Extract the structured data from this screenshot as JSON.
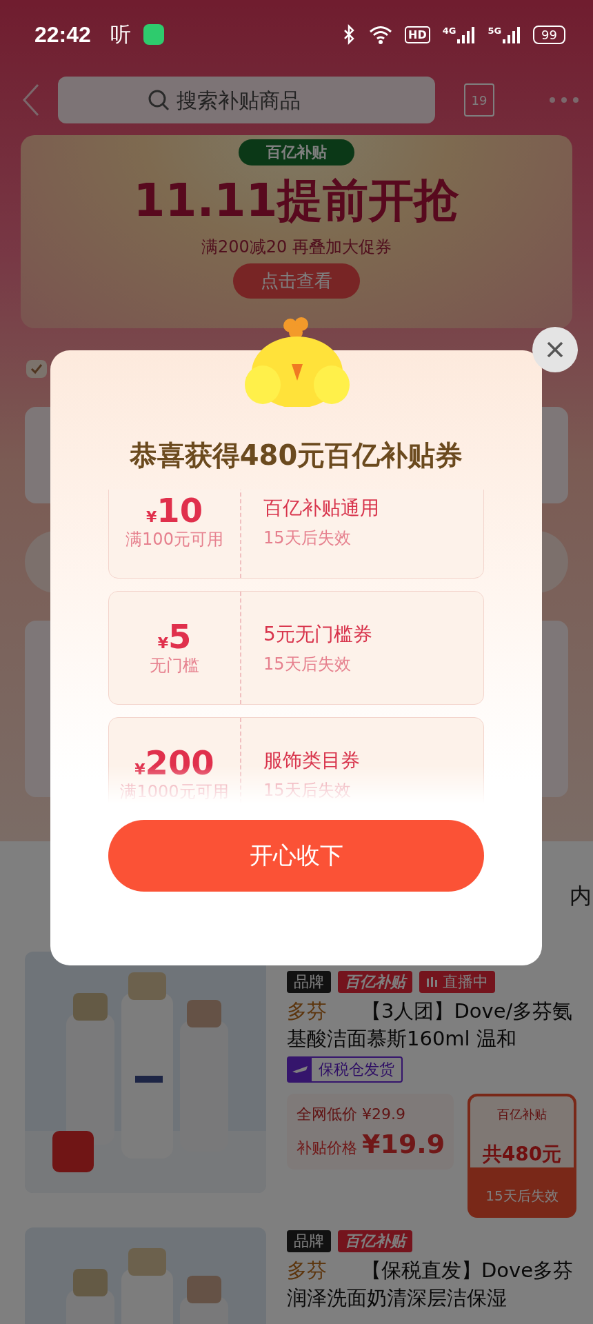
{
  "status_bar": {
    "time": "22:42",
    "app_glyph": "听",
    "network_badges": [
      {
        "kind": "hd",
        "label": "HD"
      },
      {
        "kind": "cell",
        "label": "4G"
      },
      {
        "kind": "cell",
        "label": "5G"
      }
    ],
    "battery": "99"
  },
  "header": {
    "search": {
      "placeholder": "搜索补贴商品"
    },
    "calendar_day": "19"
  },
  "banner": {
    "pill": "百亿补贴",
    "headline": "11.11提前开抢",
    "subline": "满200减20 再叠加大促券",
    "button": "点击查看"
  },
  "tab_fragment": "内",
  "products": [
    {
      "tags": [
        {
          "kind": "brand",
          "label": "品牌"
        },
        {
          "kind": "subsidy",
          "label": "百亿补贴"
        },
        {
          "kind": "live",
          "label": "直播中"
        }
      ],
      "brand": "多芬",
      "title": "【3人团】Dove/多芬氨基酸洁面慕斯160ml 温和",
      "shipping": "保税仓发货",
      "list_price_label": "全网低价",
      "list_price": "¥29.9",
      "subsidy_price_label": "补贴价格",
      "subsidy_price": "¥19.9",
      "voucher": {
        "title": "百亿补贴",
        "amount": "共480元",
        "expiry": "15天后失效"
      }
    },
    {
      "tags": [
        {
          "kind": "brand",
          "label": "品牌"
        },
        {
          "kind": "subsidy",
          "label": "百亿补贴"
        }
      ],
      "brand": "多芬",
      "title": "【保税直发】Dove多芬润泽洗面奶清深层洁保湿"
    }
  ],
  "dialog": {
    "title": "恭喜获得**480元**百亿补贴券",
    "coupons": [
      {
        "currency": "¥",
        "amount": "10",
        "condition": "满100元可用",
        "name": "百亿补贴通用",
        "expiry": "15天后失效"
      },
      {
        "currency": "¥",
        "amount": "5",
        "condition": "无门槛",
        "name": "5元无门槛券",
        "expiry": "15天后失效"
      },
      {
        "currency": "¥",
        "amount": "200",
        "condition": "满1000元可用",
        "name": "服饰类目券",
        "expiry": "15天后失效"
      }
    ],
    "confirm_button": "开心收下"
  }
}
